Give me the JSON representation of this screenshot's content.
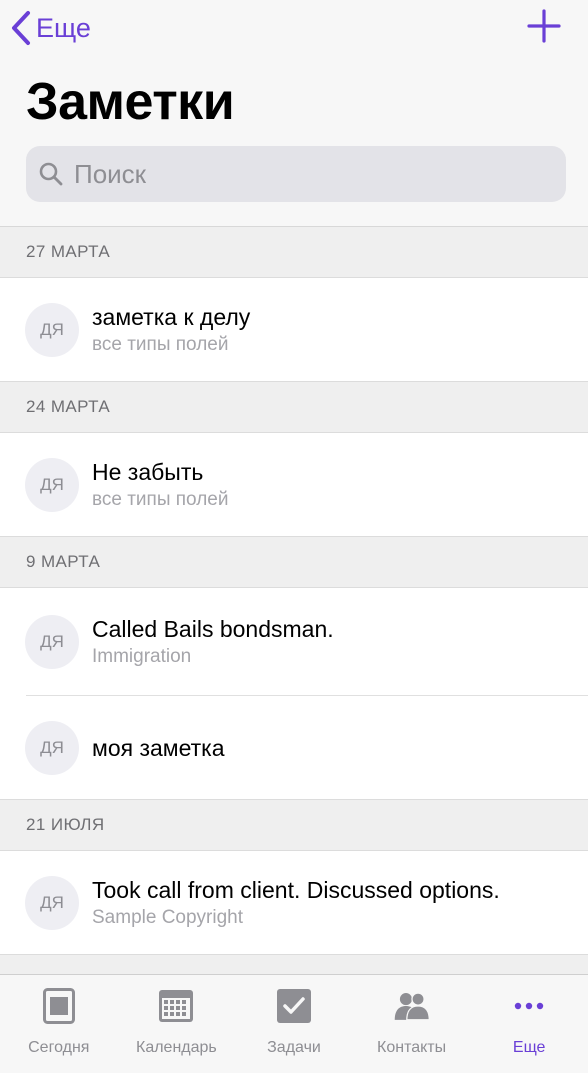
{
  "nav": {
    "back_label": "Еще"
  },
  "header": {
    "title": "Заметки"
  },
  "search": {
    "placeholder": "Поиск"
  },
  "sections": [
    {
      "date": "27 МАРТА",
      "items": [
        {
          "avatar": "ДЯ",
          "title": "заметка к делу",
          "subtitle": "все типы полей"
        }
      ]
    },
    {
      "date": "24 МАРТА",
      "items": [
        {
          "avatar": "ДЯ",
          "title": "Не забыть",
          "subtitle": "все типы полей"
        }
      ]
    },
    {
      "date": "9 МАРТА",
      "items": [
        {
          "avatar": "ДЯ",
          "title": "Called Bails bondsman.",
          "subtitle": "Immigration"
        },
        {
          "avatar": "ДЯ",
          "title": "моя заметка",
          "subtitle": ""
        }
      ]
    },
    {
      "date": "21 ИЮЛЯ",
      "items": [
        {
          "avatar": "ДЯ",
          "title": "Took call from client.  Discussed options.",
          "subtitle": "Sample Copyright"
        }
      ]
    }
  ],
  "tabbar": {
    "tabs": [
      {
        "label": "Сегодня",
        "icon": "today-icon"
      },
      {
        "label": "Календарь",
        "icon": "calendar-icon"
      },
      {
        "label": "Задачи",
        "icon": "tasks-icon"
      },
      {
        "label": "Контакты",
        "icon": "contacts-icon"
      },
      {
        "label": "Еще",
        "icon": "more-icon"
      }
    ],
    "active_index": 4
  },
  "colors": {
    "accent": "#6a3fd6",
    "inactive": "#8e8e93"
  }
}
